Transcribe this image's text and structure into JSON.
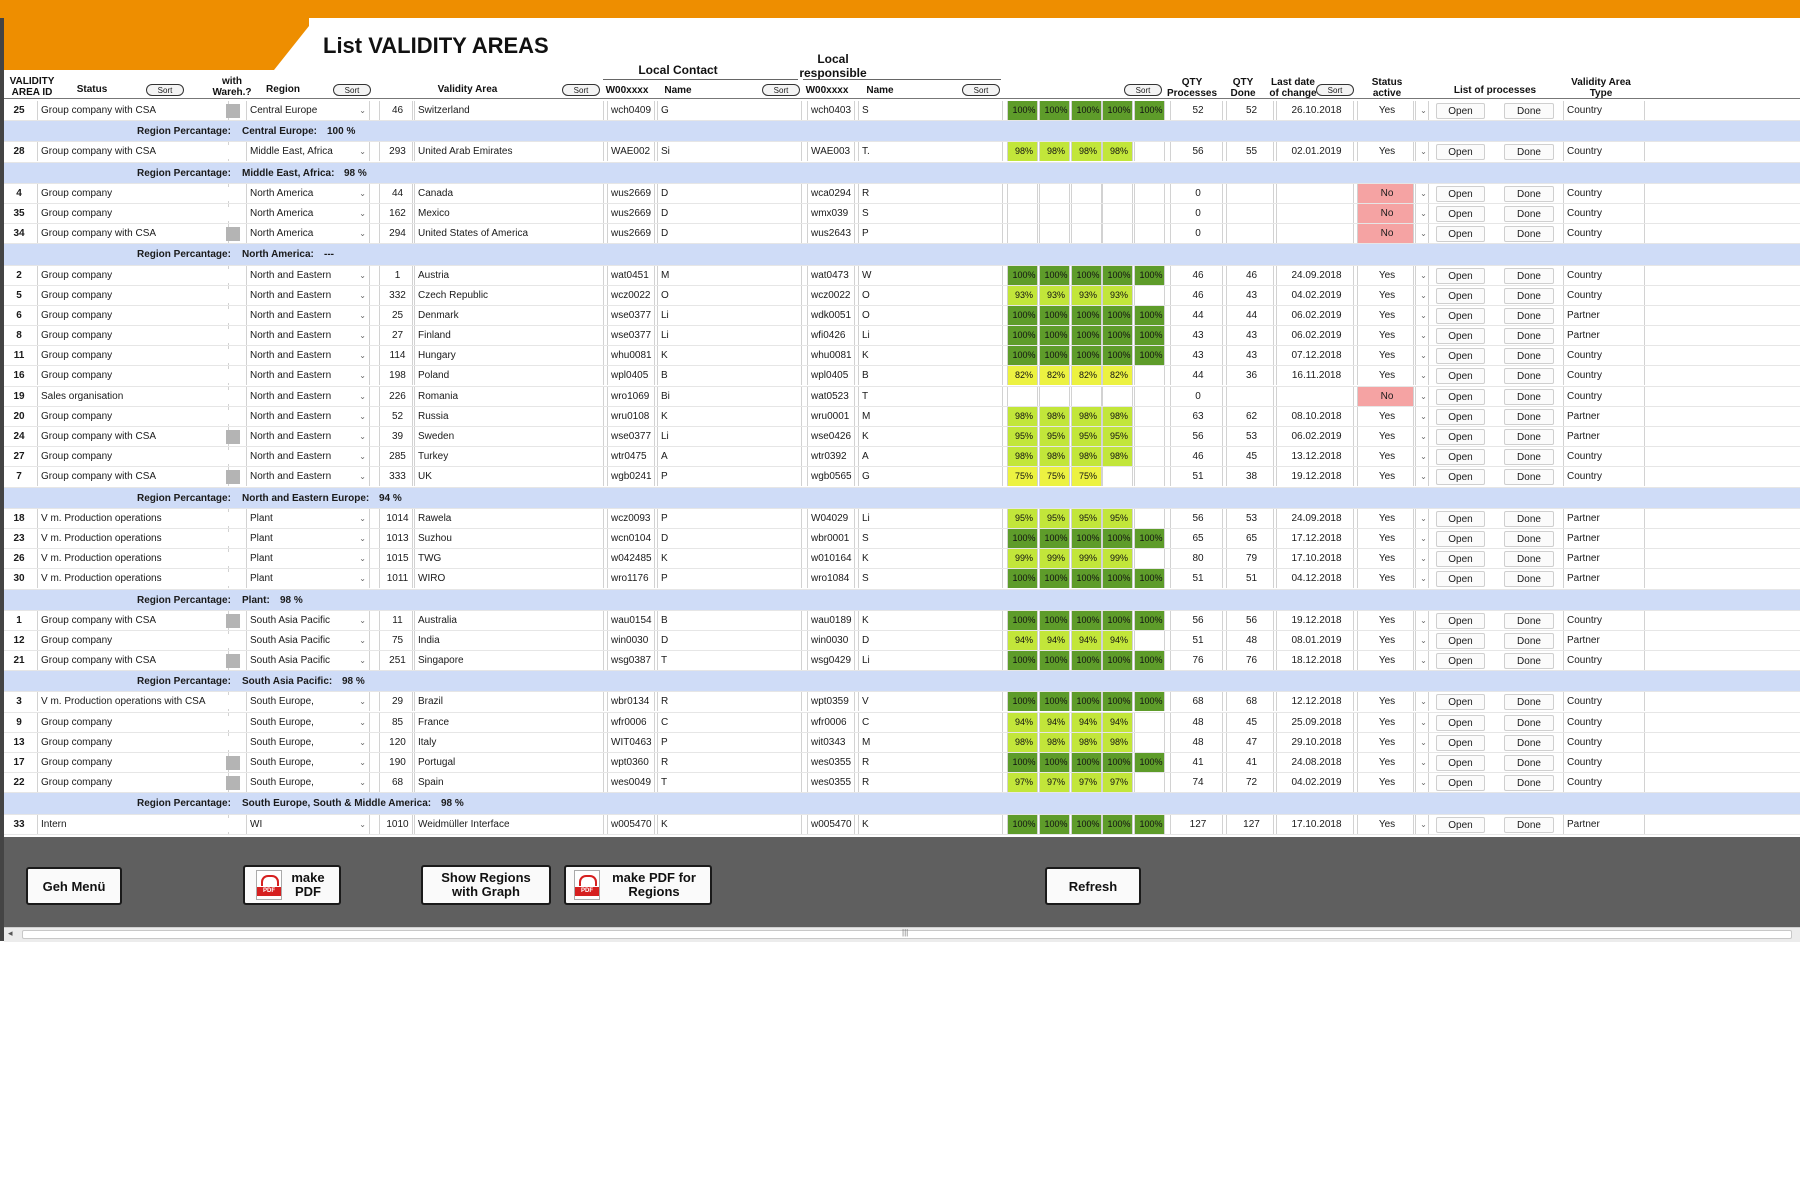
{
  "title": "List VALIDITY AREAS",
  "header": {
    "validity_area_id": "VALIDITY AREA ID",
    "status": "Status",
    "with_wareh": "with Wareh.?",
    "region": "Region",
    "validity_area": "Validity Area",
    "local_contact": "Local Contact",
    "local_responsible": "Local responsible",
    "w00xxxx_1": "W00xxxx",
    "name_1": "Name",
    "w00xxxx_2": "W00xxxx",
    "name_2": "Name",
    "qty_processes": "QTY Processes",
    "qty_done": "QTY Done",
    "last_date": "Last date of change",
    "status_active": "Status active",
    "list_of_processes": "List of processes",
    "validity_area_type": "Validity Area Type",
    "sort": "Sort"
  },
  "summary_prefix": "Region Percantage:",
  "rows": [
    {
      "kind": "data",
      "id": "25",
      "status": "Group company with CSA",
      "wareh": true,
      "region": "Central Europe",
      "num": "46",
      "area": "Switzerland",
      "w1": "wch0409",
      "n1": "G",
      "w2": "wch0403",
      "n2": "S",
      "pct": [
        "100%",
        "100%",
        "100%",
        "100%",
        "100%"
      ],
      "color": "g100",
      "qty": "52",
      "done": "52",
      "date": "26.10.2018",
      "active": "Yes",
      "open": "Open",
      "done_btn": "Done",
      "type": "Country"
    },
    {
      "kind": "sum",
      "region": "Central Europe:",
      "value": "100 %"
    },
    {
      "kind": "data",
      "id": "28",
      "status": "Group company with CSA",
      "wareh": false,
      "region": "Middle East, Africa",
      "num": "293",
      "area": "United Arab Emirates",
      "w1": "WAE002",
      "n1": "Si",
      "w2": "WAE003",
      "n2": "T.",
      "pct": [
        "98%",
        "98%",
        "98%",
        "98%",
        ""
      ],
      "color": "gy",
      "qty": "56",
      "done": "55",
      "date": "02.01.2019",
      "active": "Yes",
      "open": "Open",
      "done_btn": "Done",
      "type": "Country"
    },
    {
      "kind": "sum",
      "region": "Middle East, Africa:",
      "value": "98 %"
    },
    {
      "kind": "data",
      "id": "4",
      "status": "Group company",
      "wareh": false,
      "region": "North America",
      "num": "44",
      "area": "Canada",
      "w1": "wus2669",
      "n1": "D",
      "w2": "wca0294",
      "n2": "R",
      "pct": [
        "",
        "",
        "",
        "",
        ""
      ],
      "color": "",
      "qty": "0",
      "done": "",
      "date": "",
      "active": "No",
      "open": "Open",
      "done_btn": "Done",
      "type": "Country"
    },
    {
      "kind": "data",
      "id": "35",
      "status": "Group company",
      "wareh": false,
      "region": "North America",
      "num": "162",
      "area": "Mexico",
      "w1": "wus2669",
      "n1": "D",
      "w2": "wmx039",
      "n2": "S",
      "pct": [
        "",
        "",
        "",
        "",
        ""
      ],
      "color": "",
      "qty": "0",
      "done": "",
      "date": "",
      "active": "No",
      "open": "Open",
      "done_btn": "Done",
      "type": "Country"
    },
    {
      "kind": "data",
      "id": "34",
      "status": "Group company with CSA",
      "wareh": true,
      "region": "North America",
      "num": "294",
      "area": "United States of America",
      "w1": "wus2669",
      "n1": "D",
      "w2": "wus2643",
      "n2": "P",
      "pct": [
        "",
        "",
        "",
        "",
        ""
      ],
      "color": "",
      "qty": "0",
      "done": "",
      "date": "",
      "active": "No",
      "open": "Open",
      "done_btn": "Done",
      "type": "Country"
    },
    {
      "kind": "sum",
      "region": "North America:",
      "value": "---"
    },
    {
      "kind": "data",
      "id": "2",
      "status": "Group company",
      "wareh": false,
      "region": "North and Eastern",
      "num": "1",
      "area": "Austria",
      "w1": "wat0451",
      "n1": "M",
      "w2": "wat0473",
      "n2": "W",
      "pct": [
        "100%",
        "100%",
        "100%",
        "100%",
        "100%"
      ],
      "color": "g100",
      "qty": "46",
      "done": "46",
      "date": "24.09.2018",
      "active": "Yes",
      "open": "Open",
      "done_btn": "Done",
      "type": "Country"
    },
    {
      "kind": "data",
      "id": "5",
      "status": "Group company",
      "wareh": false,
      "region": "North and Eastern",
      "num": "332",
      "area": "Czech Republic",
      "w1": "wcz0022",
      "n1": "O",
      "w2": "wcz0022",
      "n2": "O",
      "pct": [
        "93%",
        "93%",
        "93%",
        "93%",
        ""
      ],
      "color": "gy",
      "qty": "46",
      "done": "43",
      "date": "04.02.2019",
      "active": "Yes",
      "open": "Open",
      "done_btn": "Done",
      "type": "Country"
    },
    {
      "kind": "data",
      "id": "6",
      "status": "Group company",
      "wareh": false,
      "region": "North and Eastern",
      "num": "25",
      "area": "Denmark",
      "w1": "wse0377",
      "n1": "Li",
      "w2": "wdk0051",
      "n2": "O",
      "pct": [
        "100%",
        "100%",
        "100%",
        "100%",
        "100%"
      ],
      "color": "g100",
      "qty": "44",
      "done": "44",
      "date": "06.02.2019",
      "active": "Yes",
      "open": "Open",
      "done_btn": "Done",
      "type": "Partner"
    },
    {
      "kind": "data",
      "id": "8",
      "status": "Group company",
      "wareh": false,
      "region": "North and Eastern",
      "num": "27",
      "area": "Finland",
      "w1": "wse0377",
      "n1": "Li",
      "w2": "wfi0426",
      "n2": "Li",
      "pct": [
        "100%",
        "100%",
        "100%",
        "100%",
        "100%"
      ],
      "color": "g100",
      "qty": "43",
      "done": "43",
      "date": "06.02.2019",
      "active": "Yes",
      "open": "Open",
      "done_btn": "Done",
      "type": "Partner"
    },
    {
      "kind": "data",
      "id": "11",
      "status": "Group company",
      "wareh": false,
      "region": "North and Eastern",
      "num": "114",
      "area": "Hungary",
      "w1": "whu0081",
      "n1": "K",
      "w2": "whu0081",
      "n2": "K",
      "pct": [
        "100%",
        "100%",
        "100%",
        "100%",
        "100%"
      ],
      "color": "g100",
      "qty": "43",
      "done": "43",
      "date": "07.12.2018",
      "active": "Yes",
      "open": "Open",
      "done_btn": "Done",
      "type": "Country"
    },
    {
      "kind": "data",
      "id": "16",
      "status": "Group company",
      "wareh": false,
      "region": "North and Eastern",
      "num": "198",
      "area": "Poland",
      "w1": "wpl0405",
      "n1": "B",
      "w2": "wpl0405",
      "n2": "B",
      "pct": [
        "82%",
        "82%",
        "82%",
        "82%",
        ""
      ],
      "color": "yl",
      "qty": "44",
      "done": "36",
      "date": "16.11.2018",
      "active": "Yes",
      "open": "Open",
      "done_btn": "Done",
      "type": "Country"
    },
    {
      "kind": "data",
      "id": "19",
      "status": "Sales organisation",
      "wareh": false,
      "region": "North and Eastern",
      "num": "226",
      "area": "Romania",
      "w1": "wro1069",
      "n1": "Bi",
      "w2": "wat0523",
      "n2": "T",
      "pct": [
        "",
        "",
        "",
        "",
        ""
      ],
      "color": "",
      "qty": "0",
      "done": "",
      "date": "",
      "active": "No",
      "open": "Open",
      "done_btn": "Done",
      "type": "Country"
    },
    {
      "kind": "data",
      "id": "20",
      "status": "Group company",
      "wareh": false,
      "region": "North and Eastern",
      "num": "52",
      "area": "Russia",
      "w1": "wru0108",
      "n1": "K",
      "w2": "wru0001",
      "n2": "M",
      "pct": [
        "98%",
        "98%",
        "98%",
        "98%",
        ""
      ],
      "color": "gy",
      "qty": "63",
      "done": "62",
      "date": "08.10.2018",
      "active": "Yes",
      "open": "Open",
      "done_btn": "Done",
      "type": "Partner"
    },
    {
      "kind": "data",
      "id": "24",
      "status": "Group company with CSA",
      "wareh": true,
      "region": "North and Eastern",
      "num": "39",
      "area": "Sweden",
      "w1": "wse0377",
      "n1": "Li",
      "w2": "wse0426",
      "n2": "K",
      "pct": [
        "95%",
        "95%",
        "95%",
        "95%",
        ""
      ],
      "color": "gy",
      "qty": "56",
      "done": "53",
      "date": "06.02.2019",
      "active": "Yes",
      "open": "Open",
      "done_btn": "Done",
      "type": "Partner"
    },
    {
      "kind": "data",
      "id": "27",
      "status": "Group company",
      "wareh": false,
      "region": "North and Eastern",
      "num": "285",
      "area": "Turkey",
      "w1": "wtr0475",
      "n1": "A",
      "w2": "wtr0392",
      "n2": "A",
      "pct": [
        "98%",
        "98%",
        "98%",
        "98%",
        ""
      ],
      "color": "gy",
      "qty": "46",
      "done": "45",
      "date": "13.12.2018",
      "active": "Yes",
      "open": "Open",
      "done_btn": "Done",
      "type": "Country"
    },
    {
      "kind": "data",
      "id": "7",
      "status": "Group company with CSA",
      "wareh": true,
      "region": "North and Eastern",
      "num": "333",
      "area": "UK",
      "w1": "wgb0241",
      "n1": "P",
      "w2": "wgb0565",
      "n2": "G",
      "pct": [
        "75%",
        "75%",
        "75%",
        "",
        ""
      ],
      "color": "yl",
      "qty": "51",
      "done": "38",
      "date": "19.12.2018",
      "active": "Yes",
      "open": "Open",
      "done_btn": "Done",
      "type": "Country"
    },
    {
      "kind": "sum",
      "region": "North and Eastern Europe:",
      "value": "94 %"
    },
    {
      "kind": "data",
      "id": "18",
      "status": "V     m. Production operations",
      "wareh": false,
      "region": "Plant",
      "num": "1014",
      "area": "Rawela",
      "w1": "wcz0093",
      "n1": "P",
      "w2": "W04029",
      "n2": "Li",
      "pct": [
        "95%",
        "95%",
        "95%",
        "95%",
        ""
      ],
      "color": "gy",
      "qty": "56",
      "done": "53",
      "date": "24.09.2018",
      "active": "Yes",
      "open": "Open",
      "done_btn": "Done",
      "type": "Partner"
    },
    {
      "kind": "data",
      "id": "23",
      "status": "V     m. Production operations",
      "wareh": false,
      "region": "Plant",
      "num": "1013",
      "area": "Suzhou",
      "w1": "wcn0104",
      "n1": "D",
      "w2": "wbr0001",
      "n2": "S",
      "pct": [
        "100%",
        "100%",
        "100%",
        "100%",
        "100%"
      ],
      "color": "g100",
      "qty": "65",
      "done": "65",
      "date": "17.12.2018",
      "active": "Yes",
      "open": "Open",
      "done_btn": "Done",
      "type": "Partner"
    },
    {
      "kind": "data",
      "id": "26",
      "status": "V     m. Production operations",
      "wareh": false,
      "region": "Plant",
      "num": "1015",
      "area": "TWG",
      "w1": "w042485",
      "n1": "K",
      "w2": "w010164",
      "n2": "K",
      "pct": [
        "99%",
        "99%",
        "99%",
        "99%",
        ""
      ],
      "color": "gy",
      "qty": "80",
      "done": "79",
      "date": "17.10.2018",
      "active": "Yes",
      "open": "Open",
      "done_btn": "Done",
      "type": "Partner"
    },
    {
      "kind": "data",
      "id": "30",
      "status": "V     m. Production operations",
      "wareh": false,
      "region": "Plant",
      "num": "1011",
      "area": "WIRO",
      "w1": "wro1176",
      "n1": "P",
      "w2": "wro1084",
      "n2": "S",
      "pct": [
        "100%",
        "100%",
        "100%",
        "100%",
        "100%"
      ],
      "color": "g100",
      "qty": "51",
      "done": "51",
      "date": "04.12.2018",
      "active": "Yes",
      "open": "Open",
      "done_btn": "Done",
      "type": "Partner"
    },
    {
      "kind": "sum",
      "region": "Plant:",
      "value": "98 %"
    },
    {
      "kind": "data",
      "id": "1",
      "status": "Group company with CSA",
      "wareh": true,
      "region": "South Asia Pacific",
      "num": "11",
      "area": "Australia",
      "w1": "wau0154",
      "n1": "B",
      "w2": "wau0189",
      "n2": "K",
      "pct": [
        "100%",
        "100%",
        "100%",
        "100%",
        "100%"
      ],
      "color": "g100",
      "qty": "56",
      "done": "56",
      "date": "19.12.2018",
      "active": "Yes",
      "open": "Open",
      "done_btn": "Done",
      "type": "Country"
    },
    {
      "kind": "data",
      "id": "12",
      "status": "Group company",
      "wareh": false,
      "region": "South Asia Pacific",
      "num": "75",
      "area": "India",
      "w1": "win0030",
      "n1": "D",
      "w2": "win0030",
      "n2": "D",
      "pct": [
        "94%",
        "94%",
        "94%",
        "94%",
        ""
      ],
      "color": "gy",
      "qty": "51",
      "done": "48",
      "date": "08.01.2019",
      "active": "Yes",
      "open": "Open",
      "done_btn": "Done",
      "type": "Partner"
    },
    {
      "kind": "data",
      "id": "21",
      "status": "Group company with CSA",
      "wareh": true,
      "region": "South Asia Pacific",
      "num": "251",
      "area": "Singapore",
      "w1": "wsg0387",
      "n1": "T",
      "w2": "wsg0429",
      "n2": "Li",
      "pct": [
        "100%",
        "100%",
        "100%",
        "100%",
        "100%"
      ],
      "color": "g100",
      "qty": "76",
      "done": "76",
      "date": "18.12.2018",
      "active": "Yes",
      "open": "Open",
      "done_btn": "Done",
      "type": "Country"
    },
    {
      "kind": "sum",
      "region": "South Asia Pacific:",
      "value": "98 %"
    },
    {
      "kind": "data",
      "id": "3",
      "status": "V     m. Production operations with CSA",
      "wareh": false,
      "region": "South Europe,",
      "num": "29",
      "area": "Brazil",
      "w1": "wbr0134",
      "n1": "R",
      "w2": "wpt0359",
      "n2": "V",
      "pct": [
        "100%",
        "100%",
        "100%",
        "100%",
        "100%"
      ],
      "color": "g100",
      "qty": "68",
      "done": "68",
      "date": "12.12.2018",
      "active": "Yes",
      "open": "Open",
      "done_btn": "Done",
      "type": "Country"
    },
    {
      "kind": "data",
      "id": "9",
      "status": "Group company",
      "wareh": false,
      "region": "South Europe,",
      "num": "85",
      "area": "France",
      "w1": "wfr0006",
      "n1": "C",
      "w2": "wfr0006",
      "n2": "C",
      "pct": [
        "94%",
        "94%",
        "94%",
        "94%",
        ""
      ],
      "color": "gy",
      "qty": "48",
      "done": "45",
      "date": "25.09.2018",
      "active": "Yes",
      "open": "Open",
      "done_btn": "Done",
      "type": "Country"
    },
    {
      "kind": "data",
      "id": "13",
      "status": "Group company",
      "wareh": false,
      "region": "South Europe,",
      "num": "120",
      "area": "Italy",
      "w1": "WIT0463",
      "n1": "P",
      "w2": "wit0343",
      "n2": "M",
      "pct": [
        "98%",
        "98%",
        "98%",
        "98%",
        ""
      ],
      "color": "gy",
      "qty": "48",
      "done": "47",
      "date": "29.10.2018",
      "active": "Yes",
      "open": "Open",
      "done_btn": "Done",
      "type": "Country"
    },
    {
      "kind": "data",
      "id": "17",
      "status": "Group company",
      "wareh": true,
      "region": "South Europe,",
      "num": "190",
      "area": "Portugal",
      "w1": "wpt0360",
      "n1": "R",
      "w2": "wes0355",
      "n2": "R",
      "pct": [
        "100%",
        "100%",
        "100%",
        "100%",
        "100%"
      ],
      "color": "g100",
      "qty": "41",
      "done": "41",
      "date": "24.08.2018",
      "active": "Yes",
      "open": "Open",
      "done_btn": "Done",
      "type": "Country"
    },
    {
      "kind": "data",
      "id": "22",
      "status": "Group company",
      "wareh": true,
      "region": "South Europe,",
      "num": "68",
      "area": "Spain",
      "w1": "wes0049",
      "n1": "T",
      "w2": "wes0355",
      "n2": "R",
      "pct": [
        "97%",
        "97%",
        "97%",
        "97%",
        ""
      ],
      "color": "gy",
      "qty": "74",
      "done": "72",
      "date": "04.02.2019",
      "active": "Yes",
      "open": "Open",
      "done_btn": "Done",
      "type": "Country"
    },
    {
      "kind": "sum",
      "region": "South Europe, South & Middle America:",
      "value": "98 %"
    },
    {
      "kind": "data",
      "id": "33",
      "status": "Intern",
      "wareh": false,
      "region": "WI",
      "num": "1010",
      "area": "Weidmüller Interface",
      "w1": "w005470",
      "n1": "K",
      "w2": "w005470",
      "n2": "K",
      "pct": [
        "100%",
        "100%",
        "100%",
        "100%",
        "100%"
      ],
      "color": "g100",
      "qty": "127",
      "done": "127",
      "date": "17.10.2018",
      "active": "Yes",
      "open": "Open",
      "done_btn": "Done",
      "type": "Partner"
    }
  ],
  "buttons": {
    "geh_menu": "Geh Menü",
    "make_pdf": "make PDF",
    "show_regions": "Show Regions with Graph",
    "make_pdf_regions": "make PDF for Regions",
    "refresh": "Refresh"
  },
  "colors": {
    "orange": "#ee8e00",
    "green_full": "#5e9c2a",
    "green_yellow": "#c2e63a",
    "yellow": "#ecf241",
    "no_red": "#f5a3a3",
    "summary_blue": "#cfdcf7",
    "bottom_gray": "#5f5f5f"
  }
}
